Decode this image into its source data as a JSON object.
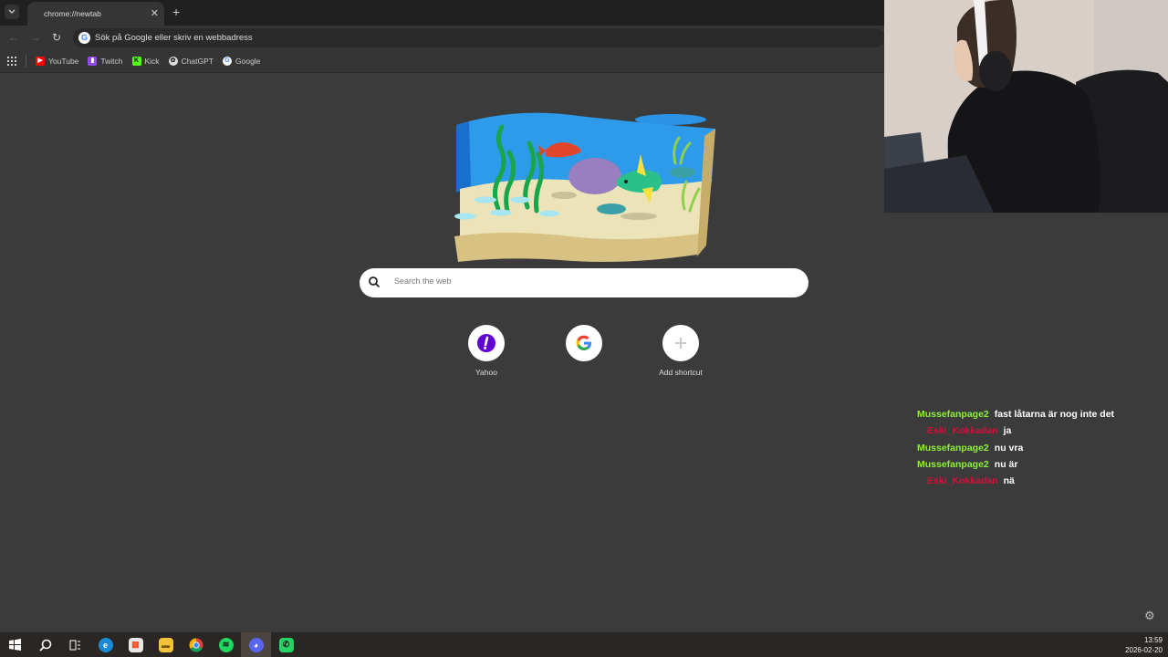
{
  "browser": {
    "tab_title": "chrome://newtab",
    "tab_close": "✕",
    "new_tab": "+",
    "omnibox_text": "Sök på Google eller skriv en webbadress",
    "bookmarks": [
      {
        "label": "YouTube",
        "icon": "youtube-icon",
        "color": "#ff0000"
      },
      {
        "label": "Twitch",
        "icon": "twitch-icon",
        "color": "#9146ff"
      },
      {
        "label": "Kick",
        "icon": "kick-icon",
        "color": "#53fc18"
      },
      {
        "label": "ChatGPT",
        "icon": "chatgpt-icon",
        "color": "#dddddd"
      },
      {
        "label": "Google",
        "icon": "google-icon",
        "color": "#4285f4"
      }
    ]
  },
  "newtab": {
    "search_placeholder": "Search the web",
    "shortcuts": [
      {
        "label": "Yahoo",
        "icon": "yahoo-icon",
        "color": "#6001d2"
      },
      {
        "label": "",
        "icon": "google-icon",
        "color": "#4285f4"
      },
      {
        "label": "Add shortcut",
        "icon": "plus-icon",
        "color": "#cccccc"
      }
    ]
  },
  "chat": {
    "messages": [
      {
        "user": "Mussefanpage2",
        "text": "fast låtarna är nog inte det",
        "color": "#8fef3a"
      },
      {
        "user": "Eski_Kokkadan",
        "text": "ja",
        "color": "#d0103a"
      },
      {
        "user": "Mussefanpage2",
        "text": "nu vra",
        "color": "#8fef3a"
      },
      {
        "user": "Mussefanpage2",
        "text": "nu är",
        "color": "#8fef3a"
      },
      {
        "user": "Eski_Kokkadan",
        "text": "nä",
        "color": "#d0103a"
      }
    ]
  },
  "taskbar": {
    "time": "13:59",
    "date": "2026-02-20",
    "items": [
      "start-icon",
      "search-icon",
      "task-view-icon",
      "edge-icon",
      "store-icon",
      "file-explorer-icon",
      "chrome-icon",
      "spotify-icon",
      "discord-icon",
      "whatsapp-icon"
    ]
  }
}
